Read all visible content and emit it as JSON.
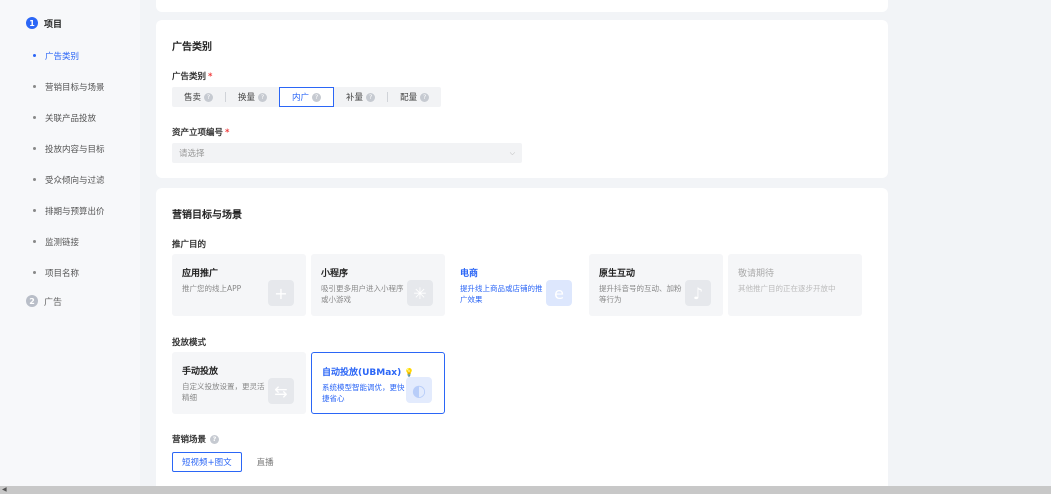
{
  "sidebar": {
    "step1": {
      "num": "1",
      "title": "项目"
    },
    "items": [
      {
        "label": "广告类别"
      },
      {
        "label": "营销目标与场景"
      },
      {
        "label": "关联产品投放"
      },
      {
        "label": "投放内容与目标"
      },
      {
        "label": "受众倾向与过滤"
      },
      {
        "label": "排期与预算出价"
      },
      {
        "label": "监测链接"
      },
      {
        "label": "项目名称"
      }
    ],
    "step2": {
      "num": "2",
      "title": "广告"
    }
  },
  "ad_category": {
    "section_title": "广告类别",
    "field_label": "广告类别",
    "required_mark": "*",
    "options": [
      {
        "label": "售卖",
        "help": "?"
      },
      {
        "label": "换量",
        "help": "?"
      },
      {
        "label": "内广",
        "help": "?"
      },
      {
        "label": "补量",
        "help": "?"
      },
      {
        "label": "配量",
        "help": "?"
      }
    ],
    "selected": "内广",
    "asset_label": "资产立项编号",
    "asset_placeholder": "请选择"
  },
  "marketing": {
    "section_title": "营销目标与场景",
    "purpose_label": "推广目的",
    "purposes": [
      {
        "title": "应用推广",
        "desc": "推广您的线上APP",
        "icon": "+"
      },
      {
        "title": "小程序",
        "desc": "吸引更多用户进入小程序或小游戏",
        "icon": "✳"
      },
      {
        "title": "电商",
        "desc": "提升线上商品或店铺的推广效果",
        "icon": "e"
      },
      {
        "title": "原生互动",
        "desc": "提升抖音号的互动、加粉等行为",
        "icon": "♪"
      },
      {
        "title": "敬请期待",
        "desc": "其他推广目的正在逐步开放中",
        "icon": ""
      }
    ],
    "selected_purpose": "电商",
    "mode_label": "投放模式",
    "modes": [
      {
        "title": "手动投放",
        "desc": "自定义投放设置，更灵活精细",
        "icon": "⇆"
      },
      {
        "title": "自动投放(UBMax)",
        "desc": "系统模型智能调优，更快捷省心",
        "icon": "◐",
        "bulb": "💡"
      }
    ],
    "selected_mode": "自动投放(UBMax)",
    "scene_label": "营销场景",
    "scene_help": "?",
    "scenes": [
      "短视频+图文",
      "直播"
    ],
    "selected_scene": "短视频+图文"
  }
}
